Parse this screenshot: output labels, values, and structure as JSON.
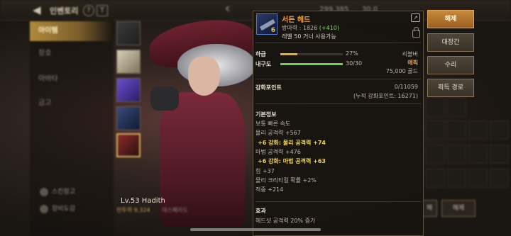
{
  "header": {
    "back_icon": "back-arrow-icon",
    "title": "인벤토리",
    "help_label": "?",
    "filter_label": "T",
    "currency_1": "299,385",
    "currency_2": "30.0"
  },
  "left_menu": {
    "items": [
      {
        "label": "아이템",
        "active": true
      },
      {
        "label": "장호",
        "active": false
      },
      {
        "label": "아바타",
        "active": false
      },
      {
        "label": "금고",
        "active": false
      }
    ],
    "bottom_links": [
      {
        "label": "스킨창고"
      },
      {
        "label": "장비도감"
      }
    ]
  },
  "character": {
    "level_name": "Lv.53 Hadith",
    "power": "전투력 9,324",
    "class": "데스페라도"
  },
  "tooltip": {
    "item_name": "서든 헤드",
    "tier": "6",
    "attack_label": "방마력 : 1826",
    "attack_bonus": "(+410)",
    "level_req": "레벨 50 거너 사용가능",
    "share_icon": "share-icon",
    "lock_icon": "lock-icon",
    "grade": {
      "label": "하급",
      "percent_text": "27%",
      "value": 0.27,
      "right": "리볼버"
    },
    "durability": {
      "label": "내구도",
      "value_text": "30/30",
      "value": 1.0,
      "rarity": "에픽",
      "price": "75,000 골드"
    },
    "enhance": {
      "label": "강화포인트",
      "value": "0/11059",
      "accum": "(누적 강화포인트: 16271)"
    },
    "basic_info": {
      "label": "기본정보",
      "lines": [
        {
          "text": "보통 빠른 속도",
          "highlight": false
        },
        {
          "text": "물리 공격력 +567",
          "highlight": false
        },
        {
          "text": "+6 강화: 물리 공격력 +74",
          "highlight": true
        },
        {
          "text": "마법 공격력 +476",
          "highlight": false
        },
        {
          "text": "+6 강화: 마법 공격력 +63",
          "highlight": true
        },
        {
          "text": "힘 +37",
          "highlight": false
        },
        {
          "text": "물리 크리티컬 확률 +2%",
          "highlight": false
        },
        {
          "text": "적중 +214",
          "highlight": false
        }
      ]
    },
    "effect": {
      "label": "효과",
      "text": "헤드샷 공격력 20% 증가"
    }
  },
  "actions": {
    "unequip": "해제",
    "forge": "대장간",
    "repair": "수리",
    "obtain_path": "획득 경로"
  },
  "bottom_buttons": {
    "left": "해",
    "right": "해제"
  },
  "colors": {
    "primary_button": "#c98a3a",
    "grade_bar": "#e0b030",
    "durability_bar": "#6fcf4a",
    "highlight_text": "#f2d25a",
    "epic": "#f0a04a"
  }
}
